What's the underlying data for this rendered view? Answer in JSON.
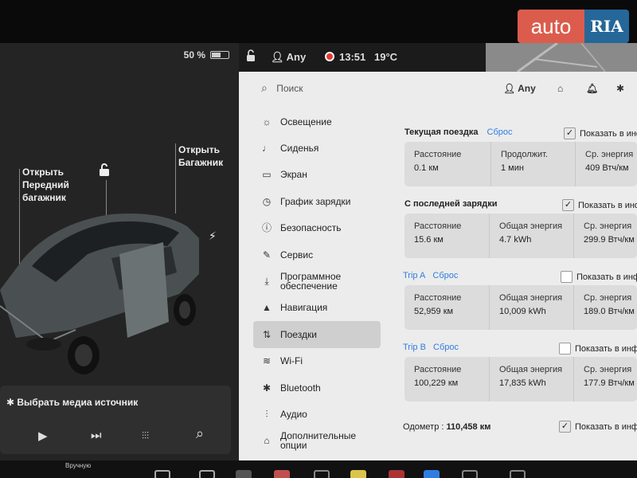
{
  "watermark": {
    "left": "auto",
    "right": "RIA"
  },
  "left_panel": {
    "battery": "50 %",
    "frunk_label": "Открыть Передний багажник",
    "trunk_label": "Открыть Багажник",
    "media": {
      "title": "✱ Выбрать медиа источник",
      "controls": {
        "play": "▶",
        "next": "⏭",
        "eq": "⫶⫶⫶",
        "search": "⌕"
      }
    }
  },
  "status_bar": {
    "lock_icon": "lock-open",
    "profile": "Any",
    "time": "13:51",
    "temp": "19°C"
  },
  "settings": {
    "search_placeholder": "Поиск",
    "header_profile": "Any",
    "nav": [
      {
        "label": "Освещение",
        "icon": "☼"
      },
      {
        "label": "Сиденья",
        "icon": "♩"
      },
      {
        "label": "Экран",
        "icon": "▭"
      },
      {
        "label": "График зарядки",
        "icon": "◷"
      },
      {
        "label": "Безопасность",
        "icon": "ⓘ"
      },
      {
        "label": "Сервис",
        "icon": "✎"
      },
      {
        "label": "Программное обеспечение",
        "icon": "⤓"
      },
      {
        "label": "Навигация",
        "icon": "▲"
      },
      {
        "label": "Поездки",
        "icon": "⇅"
      },
      {
        "label": "Wi-Fi",
        "icon": "≋"
      },
      {
        "label": "Bluetooth",
        "icon": "✱"
      },
      {
        "label": "Аудио",
        "icon": "⫶"
      },
      {
        "label": "Дополнительные опции",
        "icon": "⌂"
      }
    ],
    "active_nav": "Поездки",
    "trips": {
      "current": {
        "title": "Текущая поездка",
        "reset": "Сброс",
        "show": "Показать в инф.",
        "cells": [
          {
            "label": "Расстояние",
            "value": "0.1 км"
          },
          {
            "label": "Продолжит.",
            "value": "1 мин"
          },
          {
            "label": "Ср. энергия",
            "value": "409 Втч/км"
          }
        ]
      },
      "since_charge": {
        "title": "С последней зарядки",
        "show": "Показать в инф.",
        "cells": [
          {
            "label": "Расстояние",
            "value": "15.6 км"
          },
          {
            "label": "Общая энергия",
            "value": "4.7 kWh"
          },
          {
            "label": "Ср. энергия",
            "value": "299.9 Втч/км"
          }
        ]
      },
      "trip_a": {
        "title": "Trip A",
        "reset": "Сброс",
        "show": "Показать в инф. о",
        "cells": [
          {
            "label": "Расстояние",
            "value": "52,959 км"
          },
          {
            "label": "Общая энергия",
            "value": "10,009 kWh"
          },
          {
            "label": "Ср. энергия",
            "value": "189.0 Втч/км"
          }
        ]
      },
      "trip_b": {
        "title": "Trip B",
        "reset": "Сброс",
        "show": "Показать в инф. о",
        "cells": [
          {
            "label": "Расстояние",
            "value": "100,229 км"
          },
          {
            "label": "Общая энергия",
            "value": "17,835 kWh"
          },
          {
            "label": "Ср. энергия",
            "value": "177.9 Втч/км"
          }
        ]
      }
    },
    "odometer": {
      "label": "Одометр :",
      "value": "110,458 км",
      "show": "Показать в инф. о"
    }
  },
  "dock": {
    "label": "Вручную"
  }
}
